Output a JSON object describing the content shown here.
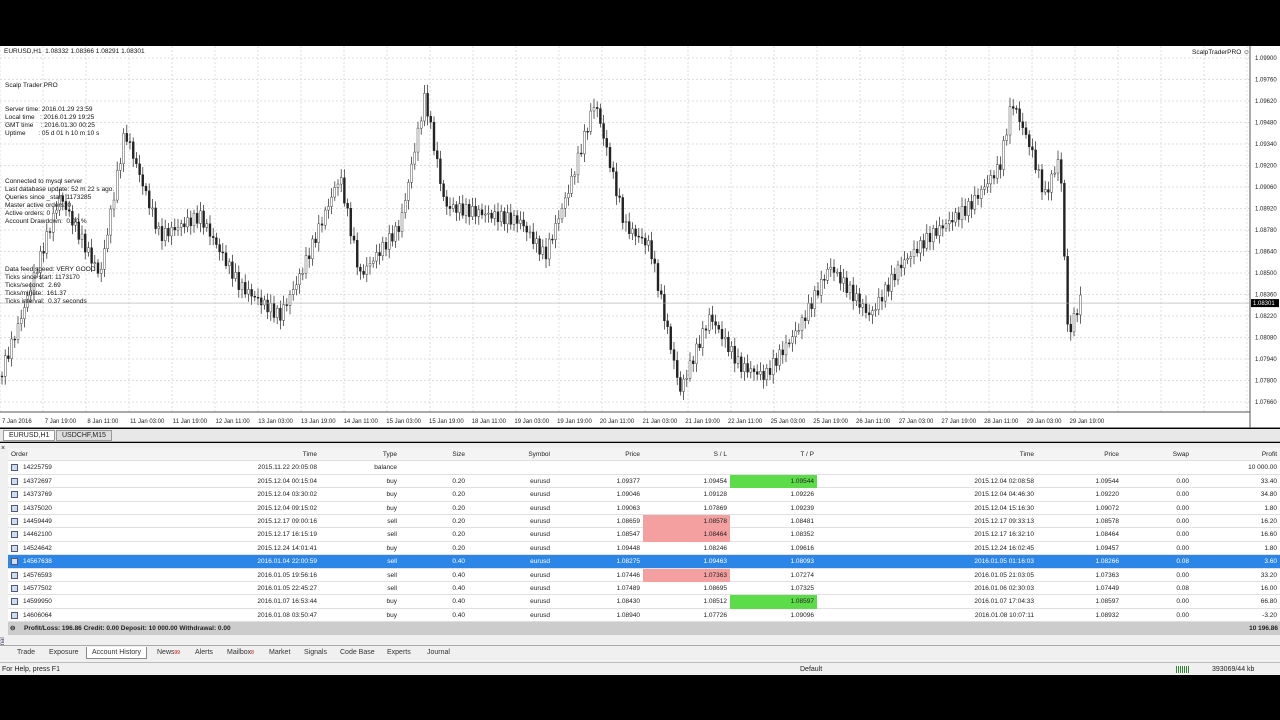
{
  "chart": {
    "symbol_info": "EURUSD,H1  1.08332 1.08366 1.08291 1.08301",
    "indicator_name": "ScalpTraderPRO ☺",
    "current_price": "1.08301",
    "price_ticks": [
      "1.09900",
      "1.09760",
      "1.09620",
      "1.09480",
      "1.09340",
      "1.09200",
      "1.09060",
      "1.08920",
      "1.08780",
      "1.08640",
      "1.08500",
      "1.08360",
      "1.08220",
      "1.08080",
      "1.07940",
      "1.07800",
      "1.07660"
    ],
    "time_ticks": [
      "7 Jan 2016",
      "7 Jan 19:00",
      "8 Jan 11:00",
      "11 Jan 03:00",
      "11 Jan 19:00",
      "12 Jan 11:00",
      "13 Jan 03:00",
      "13 Jan 19:00",
      "14 Jan 11:00",
      "15 Jan 03:00",
      "15 Jan 19:00",
      "18 Jan 11:00",
      "19 Jan 03:00",
      "19 Jan 19:00",
      "20 Jan 11:00",
      "21 Jan 03:00",
      "21 Jan 19:00",
      "22 Jan 11:00",
      "25 Jan 03:00",
      "25 Jan 19:00",
      "26 Jan 11:00",
      "27 Jan 03:00",
      "27 Jan 19:00",
      "28 Jan 11:00",
      "29 Jan 03:00",
      "29 Jan 19:00"
    ],
    "overlay": {
      "title": "Scalp Trader PRO",
      "lines1": [
        "Server time: 2016.01.29 23:59",
        "Local time   : 2016.01.29 19:25",
        "GMT time    : 2016.01.30 00:25",
        "Uptime       : 05 d 01 h 10 m 10 s"
      ],
      "lines2": [
        "Connected to mysql server",
        "Last database update: 52 m 22 s ago.",
        "Queries since _start: 1173285",
        "Master active orders: 0",
        "Active orders: 0",
        "Account Drawdown:  0.00 %"
      ],
      "lines3": [
        "Data feed speed: VERY GOOD",
        "Ticks since start: 1173170",
        "Ticks/second:  2.69",
        "Ticks/minute:  161.37",
        "Ticks interval:  0.37 seconds"
      ]
    }
  },
  "chart_tabs": [
    "EURUSD,H1",
    "USDCHF,M15"
  ],
  "history": {
    "headers": [
      "Order",
      "Time",
      "Type",
      "Size",
      "Symbol",
      "Price",
      "S / L",
      "T / P",
      "Time",
      "Price",
      "Swap",
      "Profit"
    ],
    "rows": [
      [
        "14225759",
        "2015.11.22 20:05:08",
        "balance",
        "",
        "",
        "",
        "",
        "",
        "",
        "",
        "",
        "10 000.00"
      ],
      [
        "14372697",
        "2015.12.04 00:15:04",
        "buy",
        "0.20",
        "eurusd",
        "1.09377",
        "1.09454",
        "1.09544",
        "2015.12.04 02:08:58",
        "1.09544",
        "0.00",
        "33.40"
      ],
      [
        "14373769",
        "2015.12.04 03:30:02",
        "buy",
        "0.20",
        "eurusd",
        "1.09046",
        "1.09128",
        "1.09226",
        "2015.12.04 04:46:30",
        "1.09220",
        "0.00",
        "34.80"
      ],
      [
        "14375020",
        "2015.12.04 09:15:02",
        "buy",
        "0.20",
        "eurusd",
        "1.09063",
        "1.07869",
        "1.09239",
        "2015.12.04 15:16:30",
        "1.09072",
        "0.00",
        "1.80"
      ],
      [
        "14459449",
        "2015.12.17 09:00:16",
        "sell",
        "0.20",
        "eurusd",
        "1.08659",
        "1.08578",
        "1.08481",
        "2015.12.17 09:33:13",
        "1.08578",
        "0.00",
        "16.20"
      ],
      [
        "14462100",
        "2015.12.17 16:15:19",
        "sell",
        "0.20",
        "eurusd",
        "1.08547",
        "1.08464",
        "1.08352",
        "2015.12.17 16:32:10",
        "1.08464",
        "0.00",
        "16.60"
      ],
      [
        "14524642",
        "2015.12.24 14:01:41",
        "buy",
        "0.20",
        "eurusd",
        "1.09448",
        "1.08246",
        "1.09616",
        "2015.12.24 16:02:45",
        "1.09457",
        "0.00",
        "1.80"
      ],
      [
        "14567638",
        "2016.01.04 22:00:59",
        "sell",
        "0.40",
        "eurusd",
        "1.08275",
        "1.09463",
        "1.08093",
        "2016.01.05 01:16:03",
        "1.08266",
        "0.08",
        "3.60"
      ],
      [
        "14576593",
        "2016.01.05 19:56:16",
        "sell",
        "0.40",
        "eurusd",
        "1.07446",
        "1.07363",
        "1.07274",
        "2016.01.05 21:03:05",
        "1.07363",
        "0.00",
        "33.20"
      ],
      [
        "14577502",
        "2016.01.05 22:45:27",
        "sell",
        "0.40",
        "eurusd",
        "1.07489",
        "1.08695",
        "1.07325",
        "2016.01.06 02:30:03",
        "1.07449",
        "0.08",
        "16.00"
      ],
      [
        "14599950",
        "2016.01.07 16:53:44",
        "buy",
        "0.40",
        "eurusd",
        "1.08430",
        "1.08512",
        "1.08597",
        "2016.01.07 17:04:33",
        "1.08597",
        "0.00",
        "66.80"
      ],
      [
        "14606064",
        "2016.01.08 03:50:47",
        "buy",
        "0.40",
        "eurusd",
        "1.08940",
        "1.07726",
        "1.09096",
        "2016.01.08 10:07:11",
        "1.08932",
        "0.00",
        "-3.20"
      ]
    ],
    "summary": "Profit/Loss: 196.86  Credit: 0.00  Deposit: 10 000.00  Withdrawal: 0.00",
    "summary_total": "10 196.86"
  },
  "bottom_tabs": [
    "Trade",
    "Exposure",
    "Account History",
    "News",
    "Alerts",
    "Mailbox",
    "Market",
    "Signals",
    "Code Base",
    "Experts",
    "Journal"
  ],
  "news_badge": "99",
  "mailbox_badge": "8",
  "side_label": "Terminal",
  "status": {
    "help": "For Help, press F1",
    "profile": "Default",
    "traffic": "393069/44 kb"
  },
  "colors": {
    "sl_hit": "#f4a0a0",
    "tp_hit": "#5ddc4a",
    "selected": "#2c86e8"
  }
}
